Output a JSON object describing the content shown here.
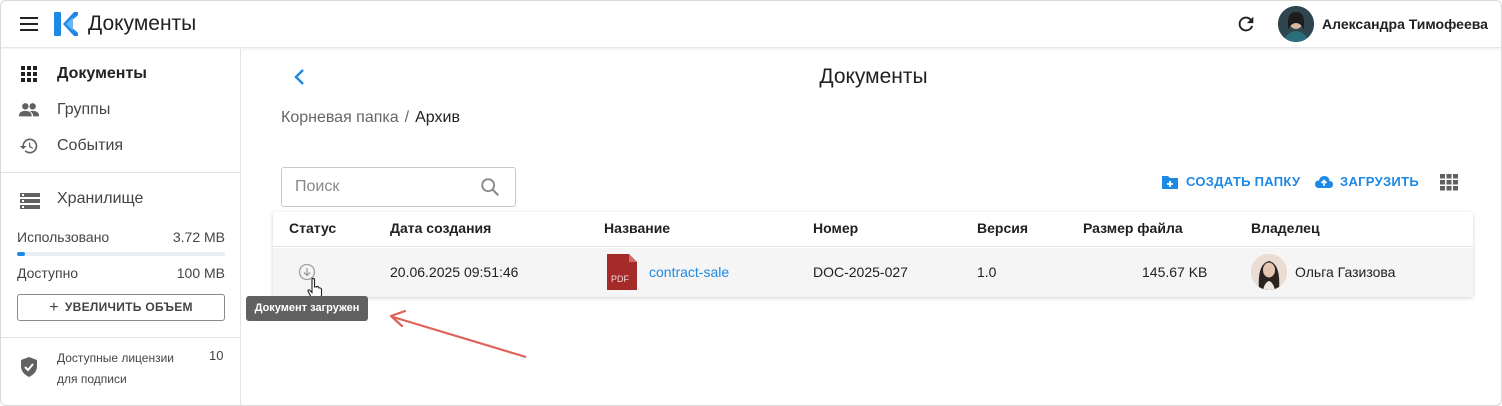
{
  "app": {
    "title": "Документы"
  },
  "header": {
    "user_name": "Александра Тимофеева"
  },
  "sidebar": {
    "items": [
      {
        "label": "Документы",
        "icon": "apps-grid-icon",
        "active": true
      },
      {
        "label": "Группы",
        "icon": "people-icon",
        "active": false
      },
      {
        "label": "События",
        "icon": "history-icon",
        "active": false
      }
    ],
    "storage": {
      "title": "Хранилище",
      "used_label": "Использовано",
      "used_value": "3.72 MB",
      "available_label": "Доступно",
      "available_value": "100 MB",
      "used_fraction": 0.0372,
      "increase_label": "УВЕЛИЧИТЬ ОБЪЕМ"
    },
    "licenses": {
      "label": "Доступные лицензии для подписи",
      "value": "10"
    }
  },
  "main": {
    "title": "Документы",
    "breadcrumb": {
      "root": "Корневая папка",
      "separator": "/",
      "current": "Архив"
    },
    "search": {
      "placeholder": "Поиск",
      "value": ""
    },
    "actions": {
      "create_folder": "СОЗДАТЬ ПАПКУ",
      "upload": "ЗАГРУЗИТЬ"
    },
    "table": {
      "columns": [
        "Статус",
        "Дата создания",
        "Название",
        "Номер",
        "Версия",
        "Размер файла",
        "Владелец"
      ],
      "rows": [
        {
          "created": "20.06.2025 09:51:46",
          "file_type": "PDF",
          "name": "contract-sale",
          "number": "DOC-2025-027",
          "version": "1.0",
          "size": "145.67 KB",
          "owner": "Ольга Газизова"
        }
      ]
    },
    "tooltip": "Документ загружен"
  },
  "colors": {
    "accent": "#1e88e5",
    "pdf_red": "#a52a2a",
    "annotation_arrow": "#e0605a"
  }
}
